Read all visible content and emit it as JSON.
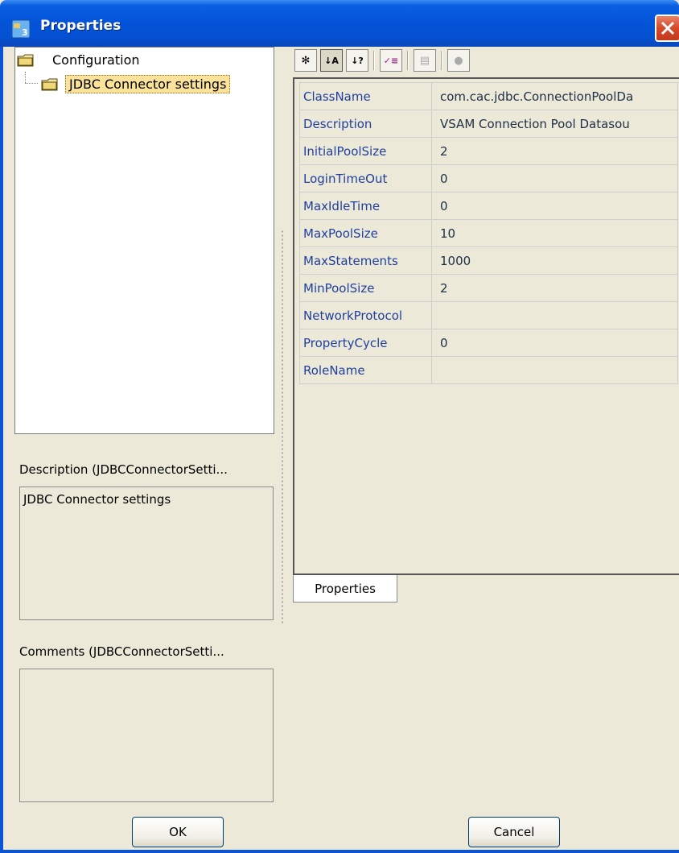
{
  "window": {
    "title": "Properties"
  },
  "tree": {
    "root_label": "Configuration",
    "child_label": "JDBC Connector settings"
  },
  "description": {
    "label": "Description (JDBCConnectorSetti...",
    "text": "JDBC Connector settings"
  },
  "comments": {
    "label": "Comments (JDBCConnectorSetti...",
    "text": ""
  },
  "toolbar": {
    "buttons": [
      {
        "name": "categorized-icon",
        "glyph": "✻"
      },
      {
        "name": "sort-alphabetical-icon",
        "glyph": "↓A"
      },
      {
        "name": "sort-reverse-icon",
        "glyph": "↓?"
      },
      {
        "name": "checklist-icon",
        "glyph": "✓≡"
      },
      {
        "name": "property-pages-icon",
        "glyph": "▤"
      },
      {
        "name": "help-icon",
        "glyph": "●"
      }
    ]
  },
  "properties": {
    "rows": [
      {
        "key": "ClassName",
        "value": "com.cac.jdbc.ConnectionPoolDa"
      },
      {
        "key": "Description",
        "value": "VSAM Connection Pool Datasou"
      },
      {
        "key": "InitialPoolSize",
        "value": "2"
      },
      {
        "key": "LoginTimeOut",
        "value": "0"
      },
      {
        "key": "MaxIdleTime",
        "value": "0"
      },
      {
        "key": "MaxPoolSize",
        "value": "10"
      },
      {
        "key": "MaxStatements",
        "value": "1000"
      },
      {
        "key": "MinPoolSize",
        "value": "2"
      },
      {
        "key": "NetworkProtocol",
        "value": ""
      },
      {
        "key": "PropertyCycle",
        "value": "0"
      },
      {
        "key": "RoleName",
        "value": ""
      }
    ]
  },
  "tab": {
    "label": "Properties"
  },
  "buttons": {
    "ok_label": "OK",
    "cancel_label": "Cancel"
  }
}
